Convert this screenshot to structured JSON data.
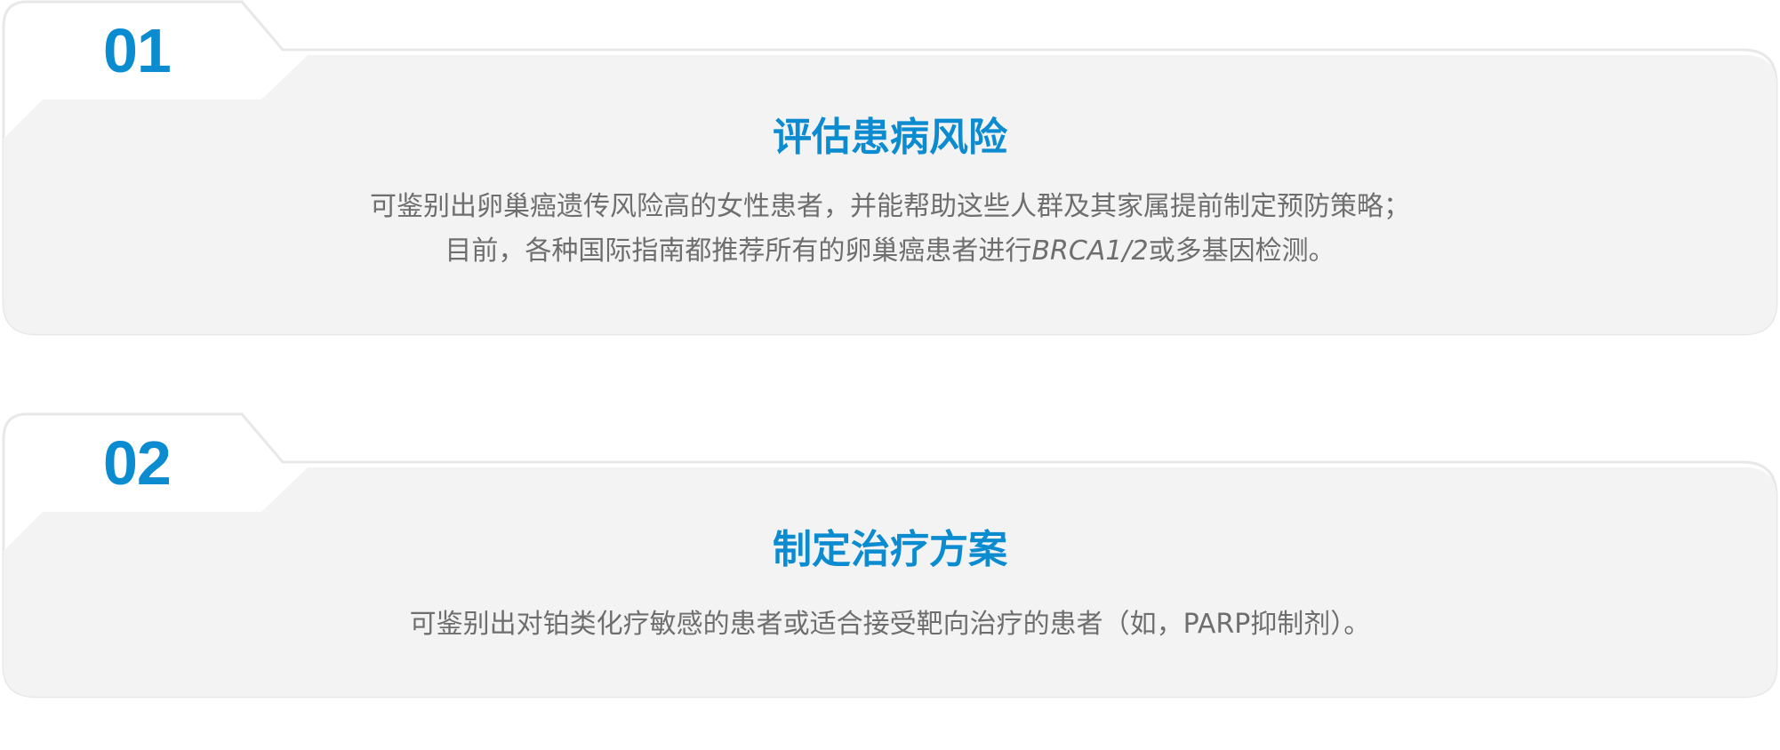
{
  "colors": {
    "accent": "#0b8bd0",
    "body_text": "#6e6e6e",
    "card_fill": "#f3f3f3",
    "card_outline": "#e8e8e8"
  },
  "cards": [
    {
      "number": "01",
      "title": "评估患病风险",
      "lines": [
        {
          "text": "可鉴别出卵巢癌遗传风险高的女性患者，并能帮助这些人群及其家属提前制定预防策略；"
        },
        {
          "prefix": "目前，各种国际指南都推荐所有的卵巢癌患者进行",
          "italic": "BRCA1/2",
          "suffix": "或多基因检测。"
        }
      ]
    },
    {
      "number": "02",
      "title": "制定治疗方案",
      "lines": [
        {
          "text": "可鉴别出对铂类化疗敏感的患者或适合接受靶向治疗的患者（如，PARP抑制剂）。"
        }
      ]
    }
  ]
}
